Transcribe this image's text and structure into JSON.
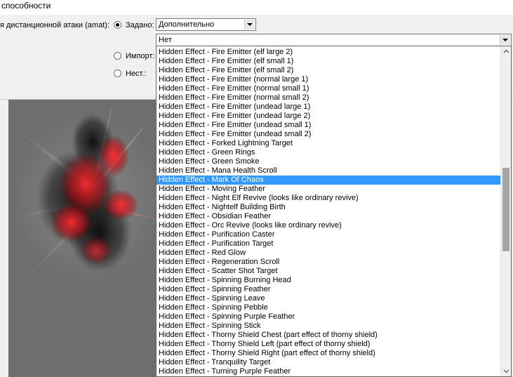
{
  "window": {
    "title": "способности"
  },
  "settings": {
    "field_label": "я дистанционной атаки (amat):",
    "options": [
      {
        "label": "Задано:",
        "checked": true
      },
      {
        "label": "Импорт:",
        "checked": false
      },
      {
        "label": "Нест.:",
        "checked": false
      }
    ],
    "preset_select": {
      "value": "Дополнительно"
    },
    "effect_select": {
      "value": "Нет"
    }
  },
  "dropdown": {
    "selected_index": 14,
    "items": [
      "Hidden Effect - Fire Emitter (elf large 2)",
      "Hidden Effect - Fire Emitter (elf small 1)",
      "Hidden Effect - Fire Emitter (elf small 2)",
      "Hidden Effect - Fire Emitter (normal large 1)",
      "Hidden Effect - Fire Emitter (normal small 1)",
      "Hidden Effect - Fire Emitter (normal small 2)",
      "Hidden Effect - Fire Emitter (undead large 1)",
      "Hidden Effect - Fire Emitter (undead large 2)",
      "Hidden Effect - Fire Emitter (undead small 1)",
      "Hidden Effect - Fire Emitter (undead small 2)",
      "Hidden Effect - Forked Lightning Target",
      "Hidden Effect - Green Rings",
      "Hidden Effect - Green Smoke",
      "Hidden Effect - Mana Health Scroll",
      "Hidden Effect - Mark Of Chaos",
      "Hidden Effect - Moving Feather",
      "Hidden Effect - Night Elf Revive (looks like ordinary revive)",
      "Hidden Effect - Nightelf Building Birth",
      "Hidden Effect - Obsidian Feather",
      "Hidden Effect - Orc Revive (looks like ordinary revive)",
      "Hidden Effect - Purification Caster",
      "Hidden Effect - Purification Target",
      "Hidden Effect - Red Glow",
      "Hidden Effect - Regeneration Scroll",
      "Hidden Effect - Scatter Shot Target",
      "Hidden Effect - Spinning Burning Head",
      "Hidden Effect - Spinning Feather",
      "Hidden Effect - Spinning Leave",
      "Hidden Effect - Spinning Pebble",
      "Hidden Effect - Spinning Purple Feather",
      "Hidden Effect - Spinning Stick",
      "Hidden Effect - Thorny Shield Chest (part effect of thorny shield)",
      "Hidden Effect - Thorny Shield Left (part effect of thorny shield)",
      "Hidden Effect - Thorny Shield Right (part effect of thorny shield)",
      "Hidden Effect - Tranquility Target",
      "Hidden Effect - Turning Purple Feather"
    ],
    "scroll": {
      "thumb_start": 0.36,
      "thumb_length": 0.27
    }
  },
  "icons": {
    "dropdown_arrow": "chevron-down-icon",
    "scroll_up": "chevron-up-icon",
    "scroll_down": "chevron-down-icon"
  },
  "colors": {
    "selection": "#3399ff",
    "window_bg": "#f0f0f0",
    "preview_bg": "#6e6e6e",
    "effect_red": "#e0101a"
  }
}
